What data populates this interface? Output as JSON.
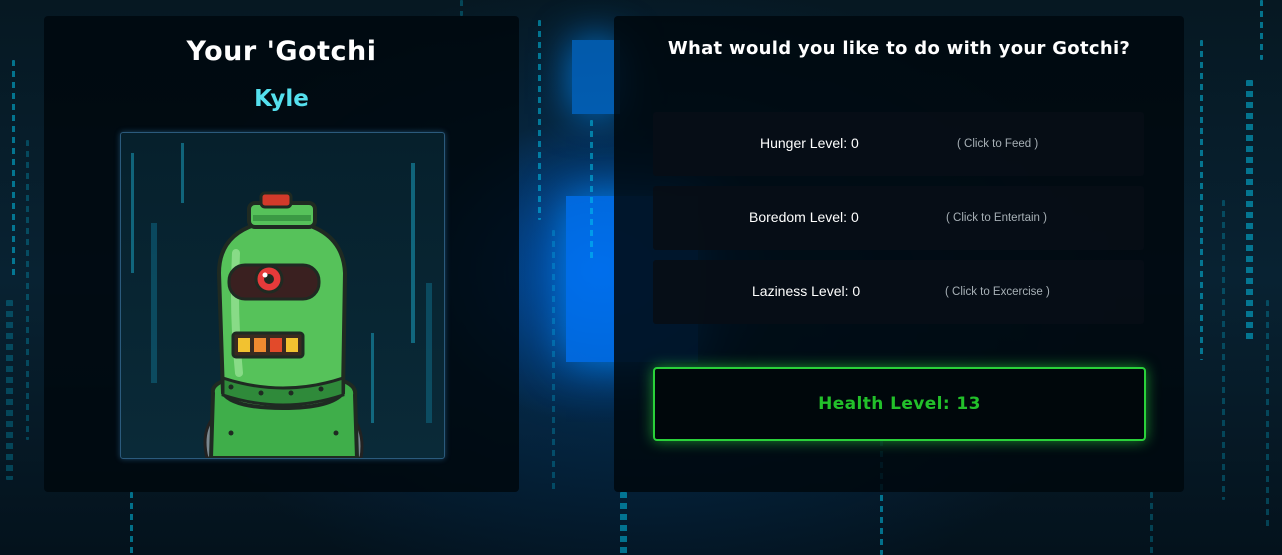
{
  "left_panel": {
    "title": "Your 'Gotchi",
    "pet_name": "Kyle"
  },
  "right_panel": {
    "title": "What would you like to do with your Gotchi?",
    "stats": [
      {
        "label": "Hunger Level: 0",
        "hint": "( Click to Feed )"
      },
      {
        "label": "Boredom Level: 0",
        "hint": "( Click to Entertain )"
      },
      {
        "label": "Laziness Level: 0",
        "hint": "( Click to Excercise )"
      }
    ],
    "health": "Health Level: 13"
  },
  "colors": {
    "pet_name": "#55e0ee",
    "health": "#22c02a",
    "health_border": "#2ad13a",
    "background": "#04121c"
  },
  "icons": [
    "robot-pet-image"
  ]
}
